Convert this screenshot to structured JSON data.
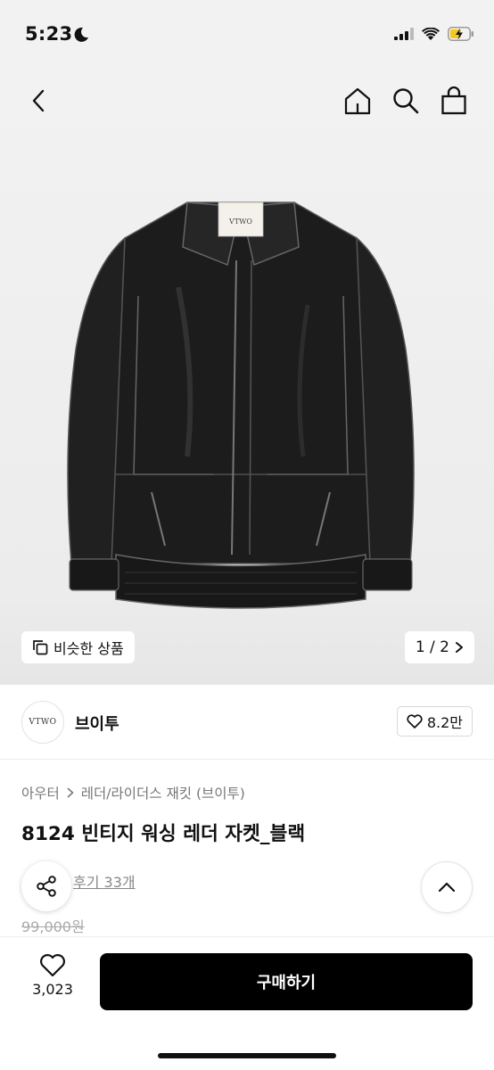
{
  "status_bar": {
    "time": "5:23"
  },
  "product": {
    "image_label": "VTWO",
    "similar_label": "비슷한 상품",
    "page_indicator": "1 / 2",
    "brand_logo_text": "VTWO",
    "brand_name": "브이투",
    "like_count": "8.2만",
    "breadcrumb": [
      "아우터",
      "레더/라이더스 재킷 (브이투)"
    ],
    "title": "8124 빈티지 워싱 레더 자켓_블랙",
    "review_link": "후기 33개",
    "original_price": "99,000원"
  },
  "bottom_bar": {
    "wish_count": "3,023",
    "buy_label": "구매하기"
  }
}
